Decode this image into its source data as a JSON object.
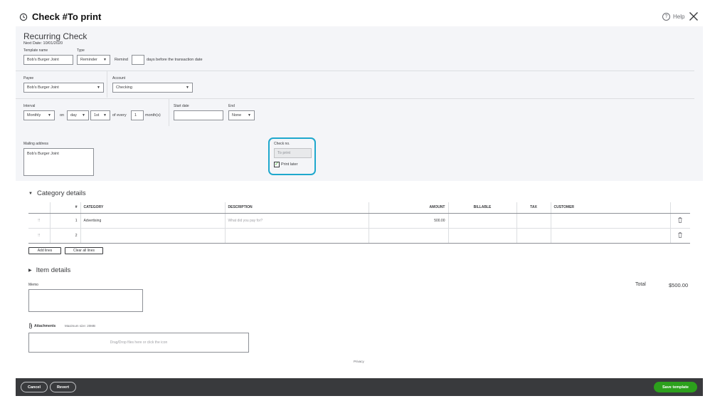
{
  "header": {
    "title": "Check #To print",
    "help_label": "Help"
  },
  "recurring": {
    "title": "Recurring Check",
    "next_date": "Next Date: 10/01/2020"
  },
  "template": {
    "name_label": "Template name",
    "name_value": "Bob's Burger Joint",
    "type_label": "Type",
    "type_value": "Reminder",
    "remind_label": "Remind",
    "remind_value": "",
    "remind_suffix": "days before the transaction date"
  },
  "payee": {
    "label": "Payee",
    "value": "Bob's Burger Joint"
  },
  "account": {
    "label": "Account",
    "value": "Checking"
  },
  "schedule": {
    "interval_label": "Interval",
    "interval_value": "Monthly",
    "on_label": "on",
    "day_value": "day",
    "day_num_value": "1st",
    "of_every_label": "of every",
    "every_value": "1",
    "months_label": "month(s)",
    "start_label": "Start date",
    "start_value": "",
    "end_label": "End",
    "end_value": "None"
  },
  "mailing": {
    "label": "Mailing address",
    "value": "Bob's Burger Joint"
  },
  "check": {
    "no_label": "Check no.",
    "no_placeholder": "To print",
    "print_later_label": "Print later",
    "print_later_checked": true
  },
  "category": {
    "title": "Category details",
    "columns": [
      "#",
      "CATEGORY",
      "DESCRIPTION",
      "AMOUNT",
      "BILLABLE",
      "TAX",
      "CUSTOMER"
    ],
    "rows": [
      {
        "num": "1",
        "category": "Advertising",
        "description_placeholder": "What did you pay for?",
        "amount": "500.00"
      },
      {
        "num": "2",
        "category": "",
        "description_placeholder": "",
        "amount": ""
      }
    ],
    "add_lines": "Add lines",
    "clear_lines": "Clear all lines"
  },
  "item": {
    "title": "Item details"
  },
  "memo": {
    "label": "Memo"
  },
  "total": {
    "label": "Total",
    "value": "$500.00"
  },
  "attachments": {
    "label": "Attachments",
    "max_size": "Maximum size: 20MB",
    "drop_text": "Drag/Drop files here or click the icon"
  },
  "privacy": "Privacy",
  "footer": {
    "cancel": "Cancel",
    "revert": "Revert",
    "save_template": "Save template"
  },
  "colors": {
    "accent_highlight": "#1fa8cd",
    "save_green": "#2ca01c",
    "footer_bg": "#393a3d",
    "panel_bg": "#f4f5f8"
  }
}
